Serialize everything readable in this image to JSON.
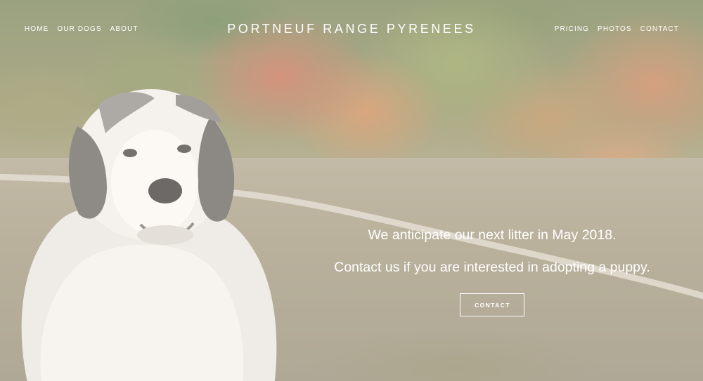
{
  "header": {
    "site_title": "PORTNEUF RANGE PYRENEES",
    "nav_left": [
      {
        "label": "HOME"
      },
      {
        "label": "OUR DOGS"
      },
      {
        "label": "ABOUT"
      }
    ],
    "nav_right": [
      {
        "label": "PRICING"
      },
      {
        "label": "PHOTOS"
      },
      {
        "label": "CONTACT"
      }
    ]
  },
  "hero": {
    "line1": "We anticipate our next litter in May 2018.",
    "line2": "Contact us if you are interested in adopting a puppy.",
    "button_label": "CONTACT"
  },
  "colors": {
    "text": "#ffffff",
    "overlay": "#fff8ee"
  }
}
